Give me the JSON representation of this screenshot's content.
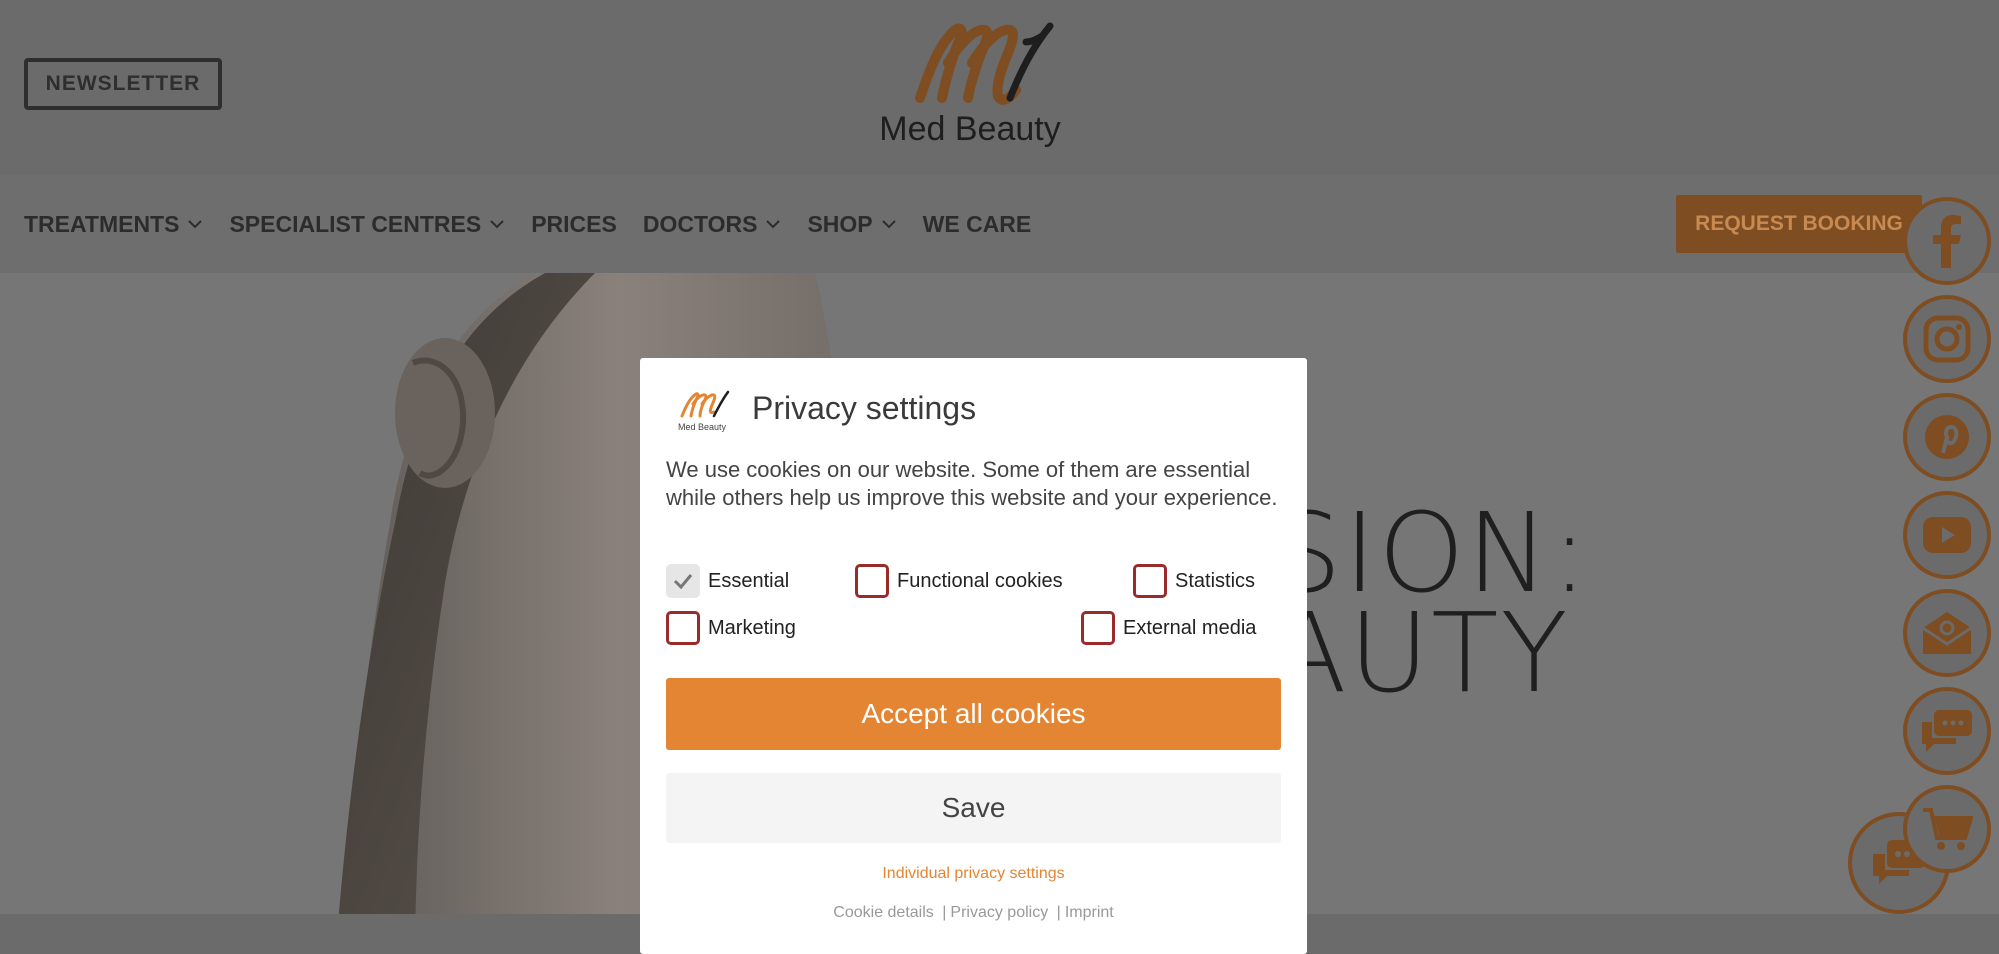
{
  "header": {
    "newsletter_label": "NEWSLETTER",
    "logo_mark": "M1",
    "logo_text": "Med Beauty"
  },
  "nav": {
    "items": [
      {
        "label": "TREATMENTS",
        "has_dropdown": true
      },
      {
        "label": "SPECIALIST CENTRES",
        "has_dropdown": true
      },
      {
        "label": "PRICES",
        "has_dropdown": false
      },
      {
        "label": "DOCTORS",
        "has_dropdown": true
      },
      {
        "label": "SHOP",
        "has_dropdown": true
      },
      {
        "label": "WE CARE",
        "has_dropdown": false
      }
    ],
    "booking_label": "REQUEST BOOKING"
  },
  "hero": {
    "line1": "SSION:",
    "line2": "EAUTY"
  },
  "social": [
    "facebook-icon",
    "instagram-icon",
    "pinterest-icon",
    "youtube-icon",
    "email-icon",
    "chat-icon",
    "cart-icon"
  ],
  "modal": {
    "title": "Privacy settings",
    "description": "We use cookies on our website. Some of them are essential while others help us improve this website and your experience.",
    "checkboxes": [
      {
        "label": "Essential",
        "checked": true
      },
      {
        "label": "Functional cookies",
        "checked": false
      },
      {
        "label": "Statistics",
        "checked": false
      },
      {
        "label": "Marketing",
        "checked": false
      },
      {
        "label": "External media",
        "checked": false
      }
    ],
    "accept_label": "Accept all cookies",
    "save_label": "Save",
    "individual_label": "Individual privacy settings",
    "footer": {
      "cookie_details": "Cookie details",
      "privacy_policy": "Privacy policy",
      "imprint": "Imprint"
    }
  },
  "colors": {
    "accent": "#e38532",
    "accent_dim": "#7e4d22",
    "overlay": "#6b6b6b",
    "checkbox_border": "#9a2b2b"
  }
}
